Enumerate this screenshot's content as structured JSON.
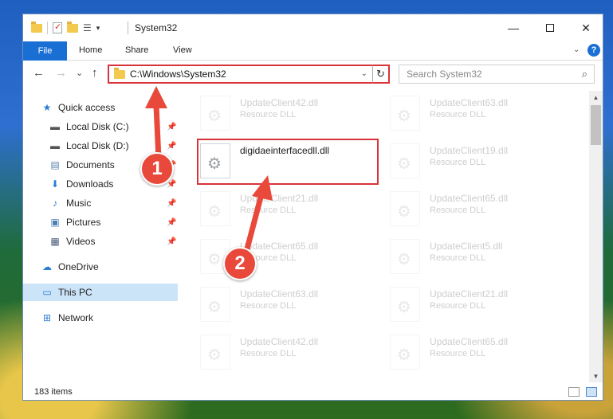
{
  "window": {
    "title": "System32",
    "controls": {
      "minimize": "—",
      "close": "✕"
    }
  },
  "ribbon": {
    "tabs": [
      "File",
      "Home",
      "Share",
      "View"
    ]
  },
  "navigation": {
    "back": "←",
    "forward": "→",
    "recent": "⌄",
    "up": "↑",
    "address": "C:\\Windows\\System32",
    "refresh": "↻",
    "search_placeholder": "Search System32"
  },
  "sidebar": {
    "items": [
      {
        "label": "Quick access",
        "icon": "star-icon",
        "glyph": "★",
        "color": "#2b7cd3",
        "pinned": false
      },
      {
        "label": "Local Disk (C:)",
        "icon": "drive-icon",
        "glyph": "▬",
        "color": "#555",
        "pinned": true
      },
      {
        "label": "Local Disk (D:)",
        "icon": "drive-icon",
        "glyph": "▬",
        "color": "#555",
        "pinned": true
      },
      {
        "label": "Documents",
        "icon": "documents-icon",
        "glyph": "▤",
        "color": "#5a7fb0",
        "pinned": true
      },
      {
        "label": "Downloads",
        "icon": "downloads-icon",
        "glyph": "⬇",
        "color": "#2b7cd3",
        "pinned": true
      },
      {
        "label": "Music",
        "icon": "music-icon",
        "glyph": "♪",
        "color": "#2b7cd3",
        "pinned": true
      },
      {
        "label": "Pictures",
        "icon": "pictures-icon",
        "glyph": "▣",
        "color": "#4a7fb5",
        "pinned": true
      },
      {
        "label": "Videos",
        "icon": "videos-icon",
        "glyph": "▦",
        "color": "#4a5a7a",
        "pinned": true
      },
      {
        "label": "OneDrive",
        "icon": "cloud-icon",
        "glyph": "☁",
        "color": "#2b7cd3",
        "pinned": false
      },
      {
        "label": "This PC",
        "icon": "computer-icon",
        "glyph": "▭",
        "color": "#2b7cd3",
        "pinned": false,
        "selected": true
      },
      {
        "label": "Network",
        "icon": "network-icon",
        "glyph": "⊞",
        "color": "#2b7cd3",
        "pinned": false
      }
    ]
  },
  "files": {
    "left": [
      {
        "name": "UpdateClient42.dll",
        "type": "Resource DLL",
        "faded": true
      },
      {
        "name": "digidaeinterfacedll.dll",
        "type": "",
        "faded": false,
        "highlighted": true
      },
      {
        "name": "UpdateClient21.dll",
        "type": "Resource DLL",
        "faded": true
      },
      {
        "name": "UpdateClient65.dll",
        "type": "Resource DLL",
        "faded": true
      },
      {
        "name": "UpdateClient63.dll",
        "type": "Resource DLL",
        "faded": true
      },
      {
        "name": "UpdateClient42.dll",
        "type": "Resource DLL",
        "faded": true
      }
    ],
    "right": [
      {
        "name": "UpdateClient63.dll",
        "type": "Resource DLL",
        "faded": true
      },
      {
        "name": "UpdateClient19.dll",
        "type": "Resource DLL",
        "faded": true
      },
      {
        "name": "UpdateClient65.dll",
        "type": "Resource DLL",
        "faded": true
      },
      {
        "name": "UpdateClient5.dll",
        "type": "Resource DLL",
        "faded": true
      },
      {
        "name": "UpdateClient21.dll",
        "type": "Resource DLL",
        "faded": true
      },
      {
        "name": "UpdateClient65.dll",
        "type": "Resource DLL",
        "faded": true
      }
    ]
  },
  "status": {
    "count": "183 items"
  },
  "annotations": {
    "step1": "1",
    "step2": "2",
    "color": "#e8493b"
  }
}
